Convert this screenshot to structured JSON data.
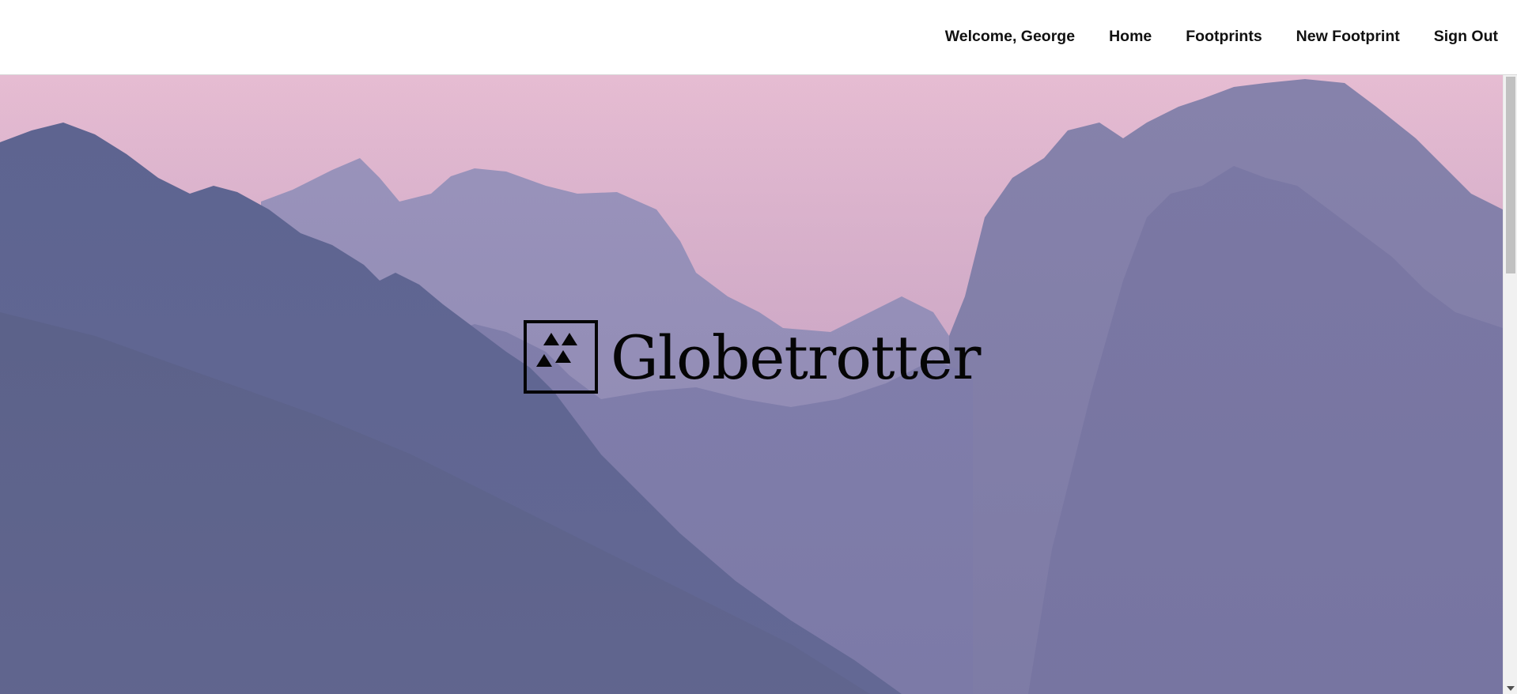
{
  "nav": {
    "welcome": "Welcome, George",
    "links": {
      "home": "Home",
      "footprints": "Footprints",
      "new_footprint": "New Footprint",
      "sign_out": "Sign Out"
    }
  },
  "hero": {
    "brand_name": "Globetrotter",
    "logo_icon": "triangles-logo-icon",
    "background": "mountain-range-photo"
  },
  "colors": {
    "sky": "#e6bcd2",
    "text": "#111111",
    "mountain_far": "#9a93bb",
    "mountain_mid": "#7a78a5",
    "mountain_near": "#555b85"
  }
}
